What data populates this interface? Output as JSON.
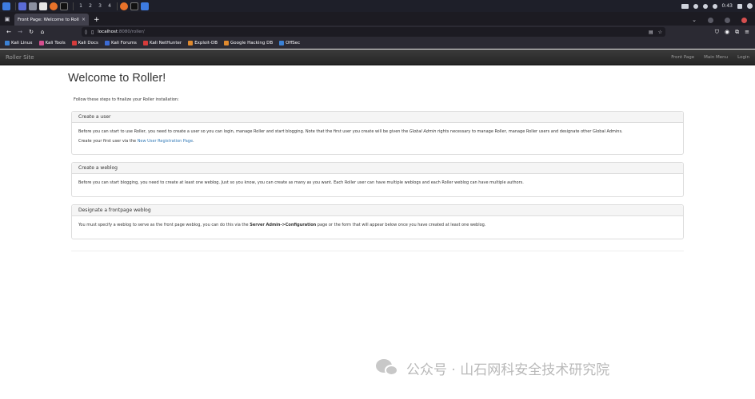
{
  "taskbar": {
    "workspaces": [
      "1",
      "2",
      "3",
      "4"
    ],
    "clock": "0:43"
  },
  "browser": {
    "tab_title": "Front Page: Welcome to Roll",
    "tab_close": "×",
    "new_tab": "+",
    "url_host": "localhost",
    "url_rest": ":8080/roller/"
  },
  "bookmarks": [
    {
      "label": "Kali Linux",
      "color": "#3b82d6"
    },
    {
      "label": "Kali Tools",
      "color": "#d64f8f"
    },
    {
      "label": "Kali Docs",
      "color": "#d63b3b"
    },
    {
      "label": "Kali Forums",
      "color": "#3b6bd6"
    },
    {
      "label": "Kali NetHunter",
      "color": "#d63b3b"
    },
    {
      "label": "Exploit-DB",
      "color": "#e08a2e"
    },
    {
      "label": "Google Hacking DB",
      "color": "#e08a2e"
    },
    {
      "label": "OffSec",
      "color": "#3b82d6"
    }
  ],
  "site": {
    "brand": "Roller Site",
    "nav": [
      "Front Page",
      "Main Menu",
      "Login"
    ]
  },
  "main": {
    "title": "Welcome to Roller!",
    "intro": "Follow these steps to finalize your Roller installation:",
    "panels": [
      {
        "heading": "Create a user",
        "p1_a": "Before you can start to use Roller, you need to create a user so you can login, manage Roller and start blogging. Note that the first user you create will be given the ",
        "p1_em": "Global Admin",
        "p1_b": " rights necessary to manage Roller, manage Roller users and designate other Global Admins.",
        "p2_a": "Create your first user via the ",
        "p2_link": "New User Registration Page",
        "p2_b": "."
      },
      {
        "heading": "Create a weblog",
        "p1": "Before you can start blogging, you need to create at least one weblog. Just so you know, you can create as many as you want. Each Roller user can have multiple weblogs and each Roller weblog can have multiple authors."
      },
      {
        "heading": "Designate a frontpage weblog",
        "p1_a": "You must specify a weblog to serve as the front page weblog, you can do this via the ",
        "p1_strong": "Server Admin->Configuration",
        "p1_b": " page or the form that will appear below once you have created at least one weblog."
      }
    ]
  },
  "watermark": {
    "text": "公众号 · 山石网科安全技术研究院"
  },
  "colors": {
    "link": "#337ab7",
    "header_bg": "#262626",
    "browser_chrome": "#2b2a33"
  }
}
